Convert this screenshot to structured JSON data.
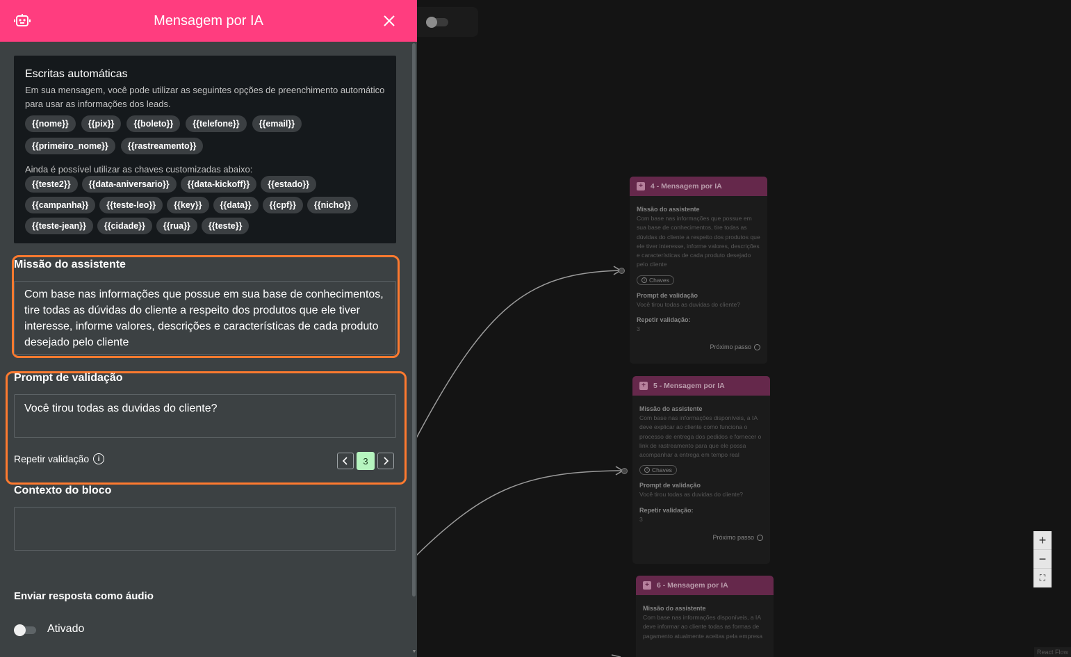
{
  "panel": {
    "title": "Mensagem por IA",
    "auto_writes": {
      "title": "Escritas automáticas",
      "description": "Em sua mensagem, você pode utilizar as seguintes opções de preenchimento automático para usar as informações dos leads.",
      "default_keys": [
        "{{nome}}",
        "{{pix}}",
        "{{boleto}}",
        "{{telefone}}",
        "{{email}}",
        "{{primeiro_nome}}",
        "{{rastreamento}}"
      ],
      "custom_intro": "Ainda é possível utilizar as chaves customizadas abaixo:",
      "custom_keys": [
        "{{teste2}}",
        "{{data-aniversario}}",
        "{{data-kickoff}}",
        "{{estado}}",
        "{{campanha}}",
        "{{teste-leo}}",
        "{{key}}",
        "{{data}}",
        "{{cpf}}",
        "{{nicho}}",
        "{{teste-jean}}",
        "{{cidade}}",
        "{{rua}}",
        "{{teste}}"
      ]
    },
    "mission": {
      "label": "Missão do assistente",
      "value": "Com base nas informações que possue em sua base de conhecimentos, tire todas as dúvidas do cliente a respeito dos produtos que ele tiver interesse, informe valores, descrições e características de cada produto desejado pelo cliente"
    },
    "validation": {
      "label": "Prompt de validação",
      "value": "Você tirou todas as duvidas do cliente?",
      "repeat_label": "Repetir validação",
      "repeat_value": "3"
    },
    "context": {
      "label": "Contexto do bloco",
      "value": ""
    },
    "audio": {
      "label": "Enviar resposta como áudio",
      "toggle_label": "Ativado",
      "enabled": false
    }
  },
  "nodes": [
    {
      "title": "4 - Mensagem por IA",
      "mission_label": "Missão do assistente",
      "mission_text": "Com base nas informações que possue em sua base de conhecimentos, tire todas as dúvidas do cliente a respeito dos produtos que ele tiver interesse, informe valores, descrições e características de cada produto desejado pelo cliente",
      "chip_label": "Chaves",
      "prompt_label": "Prompt de validação",
      "prompt_text": "Você tirou todas as duvidas do cliente?",
      "repeat_label": "Repetir validação:",
      "repeat_value": "3",
      "next_label": "Próximo passo"
    },
    {
      "title": "5 - Mensagem por IA",
      "mission_label": "Missão do assistente",
      "mission_text": "Com base nas informações disponíveis, a IA deve explicar ao cliente como funciona o processo de entrega dos pedidos e fornecer o link de rastreamento para que ele possa acompanhar a entrega em tempo real",
      "chip_label": "Chaves",
      "prompt_label": "Prompt de validação",
      "prompt_text": "Você tirou todas as duvidas do cliente?",
      "repeat_label": "Repetir validação:",
      "repeat_value": "3",
      "next_label": "Próximo passo"
    },
    {
      "title": "6 - Mensagem por IA",
      "mission_label": "Missão do assistente",
      "mission_text": "Com base nas informações disponíveis, a IA deve informar ao cliente todas as formas de pagamento atualmente aceitas pela empresa"
    }
  ],
  "controls": {
    "zoom_in": "+",
    "zoom_out": "−",
    "fit_view": "⛶"
  },
  "attribution": "React Flow",
  "colors": {
    "header": "#ff3d7f",
    "panel": "#3c4143",
    "highlight_border": "#ff7a2f",
    "node_header": "#6c2a50",
    "stepper_value": "#b6f5bf"
  }
}
